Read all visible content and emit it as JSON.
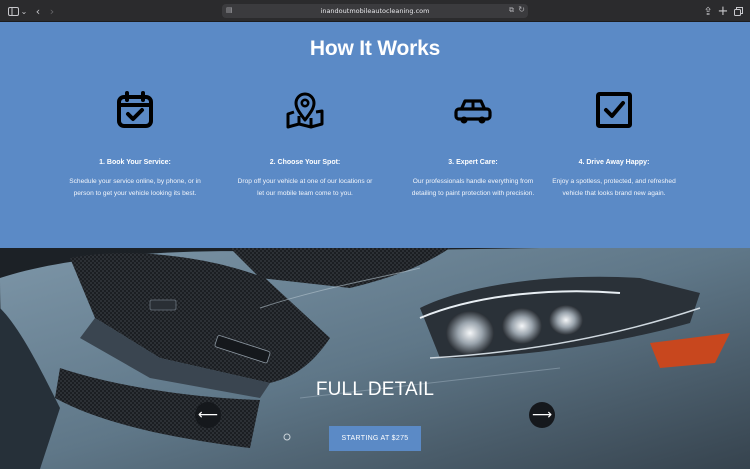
{
  "browser": {
    "url": "inandoutmobileautocleaning.com",
    "icons": [
      "sidebar-icon",
      "back-icon",
      "forward-icon",
      "page-icon",
      "translate-icon",
      "reload-icon",
      "share-icon",
      "new-tab-icon",
      "tabs-icon"
    ]
  },
  "how_it_works": {
    "title": "How It Works",
    "steps": [
      {
        "icon": "calendar-check-icon",
        "heading": "1. Book Your Service:",
        "text": "Schedule your service online, by phone, or in person to get your vehicle looking its best."
      },
      {
        "icon": "map-pin-icon",
        "heading": "2. Choose Your Spot:",
        "text": "Drop off your vehicle at one of our locations or let our mobile team come to you."
      },
      {
        "icon": "car-icon",
        "heading": "3. Expert Care:",
        "text": "Our professionals handle everything from detailing to paint protection with precision."
      },
      {
        "icon": "checkbox-icon",
        "heading": "4. Drive Away Happy:",
        "text": "Enjoy a spotless, protected, and refreshed vehicle that looks brand new again."
      }
    ]
  },
  "hero": {
    "title": "FULL DETAIL",
    "cta": "STARTING AT $275",
    "prev_arrow": "⟵",
    "next_arrow": "⟶"
  },
  "colors": {
    "accent": "#5b8ac6",
    "chrome": "#2b2b2d"
  }
}
